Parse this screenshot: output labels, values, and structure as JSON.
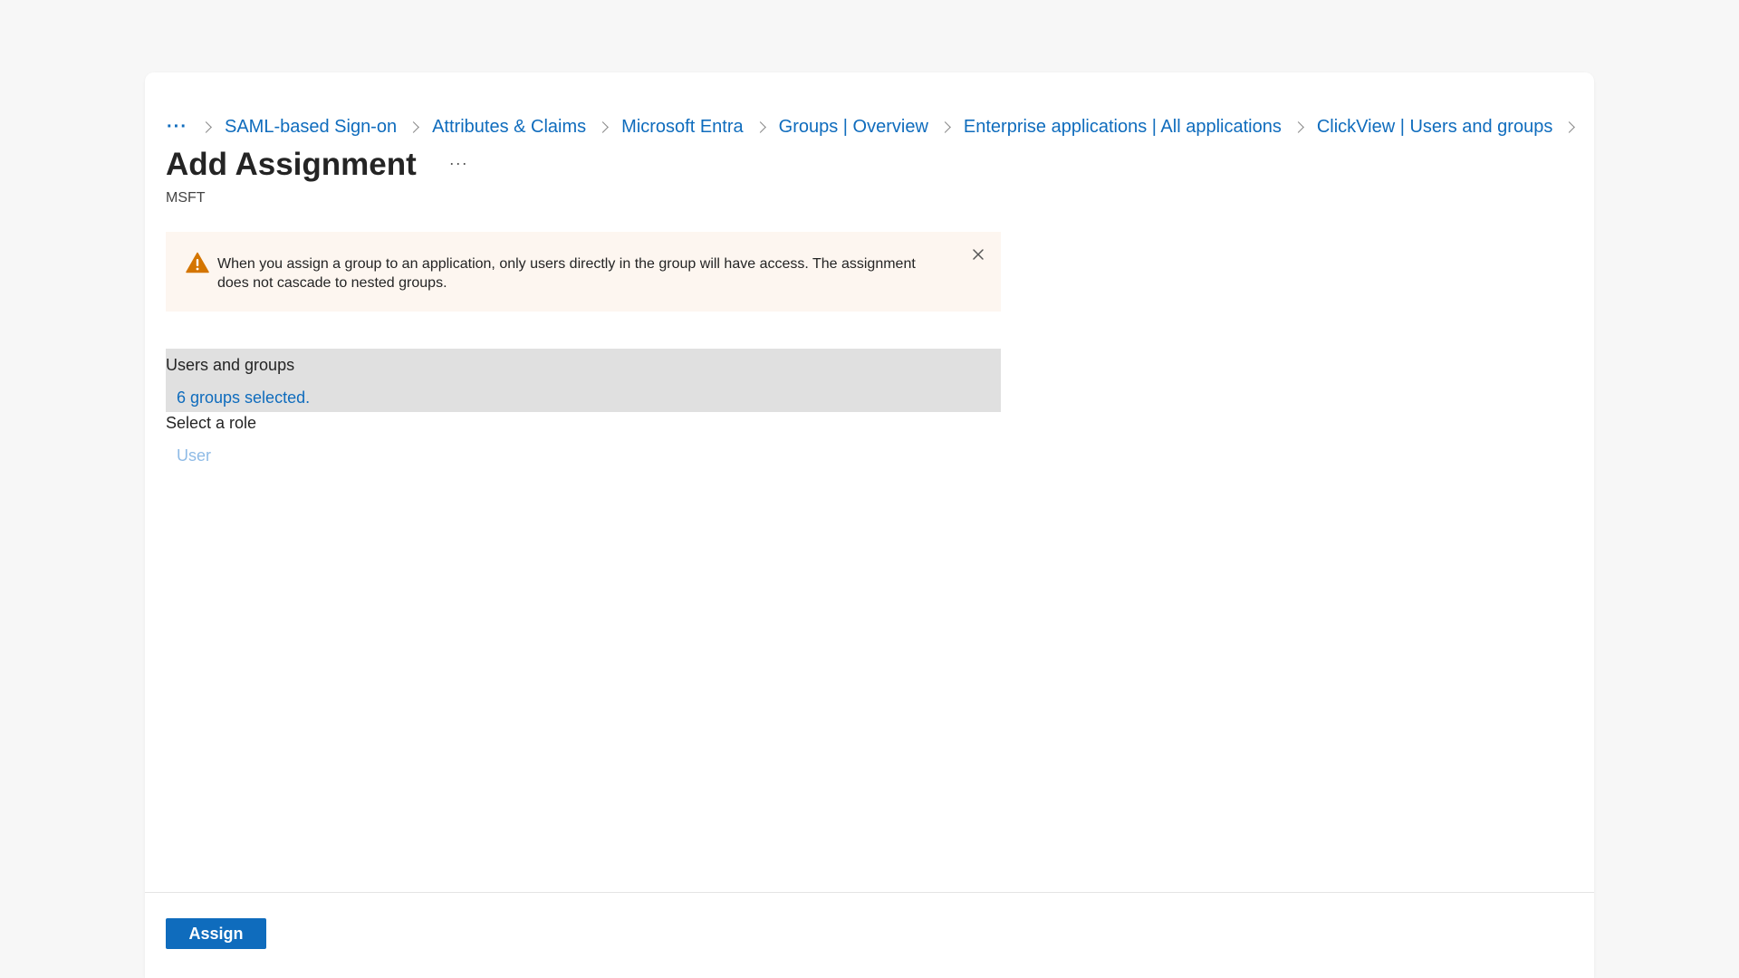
{
  "breadcrumb": {
    "more": "···",
    "items": [
      {
        "label": "SAML-based Sign-on"
      },
      {
        "label": "Attributes & Claims"
      },
      {
        "label": "Microsoft Entra"
      },
      {
        "label": "Groups | Overview"
      },
      {
        "label": "Enterprise applications | All applications"
      },
      {
        "label": "ClickView | Users and groups"
      }
    ]
  },
  "header": {
    "title": "Add Assignment",
    "more": "···",
    "subtitle": "MSFT"
  },
  "warning": {
    "text": "When you assign a group to an application, only users directly in the group will have access. The assignment does not cascade to nested groups.",
    "icon": "warning-icon",
    "close_icon": "close-icon",
    "color": "#d47500"
  },
  "form": {
    "users_groups_label": "Users and groups",
    "users_groups_value": "6 groups selected.",
    "role_label": "Select a role",
    "role_value": "User"
  },
  "footer": {
    "assign_label": "Assign"
  },
  "colors": {
    "accent": "#0f6cbd",
    "warning_bg": "#fdf6f0",
    "selected_bg": "#e0e0e0"
  }
}
